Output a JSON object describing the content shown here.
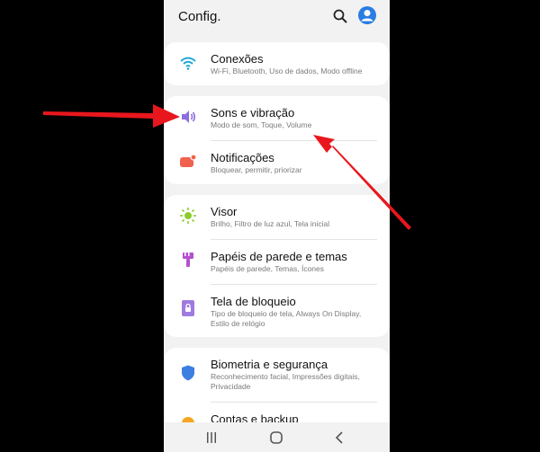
{
  "header": {
    "title": "Config."
  },
  "items": [
    {
      "title": "Conexões",
      "subtitle": "Wi-Fi, Bluetooth, Uso de dados, Modo offline"
    },
    {
      "title": "Sons e vibração",
      "subtitle": "Modo de som, Toque, Volume"
    },
    {
      "title": "Notificações",
      "subtitle": "Bloquear, permitir, priorizar"
    },
    {
      "title": "Visor",
      "subtitle": "Brilho, Filtro de luz azul, Tela inicial"
    },
    {
      "title": "Papéis de parede e temas",
      "subtitle": "Papéis de parede, Temas, Ícones"
    },
    {
      "title": "Tela de bloqueio",
      "subtitle": "Tipo de bloqueio de tela, Always On Display, Estilo de relógio"
    },
    {
      "title": "Biometria e segurança",
      "subtitle": "Reconhecimento facial, Impressões digitais, Privacidade"
    },
    {
      "title": "Contas e backup",
      "subtitle": ""
    }
  ],
  "colors": {
    "accent_blue": "#2a7de1",
    "arrow_red": "#e8171d"
  }
}
